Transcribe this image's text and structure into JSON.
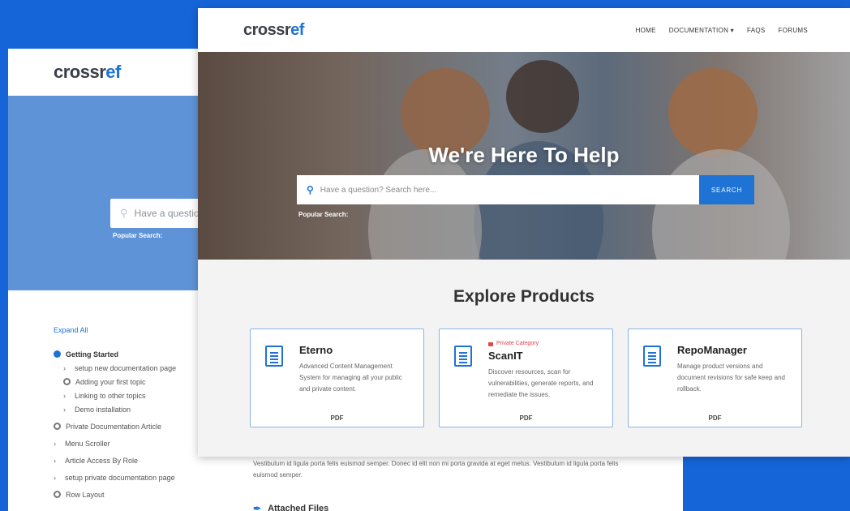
{
  "back": {
    "logo": {
      "part1": "crossr",
      "part2": "ef"
    },
    "search": {
      "placeholder": "Have a questio"
    },
    "popular_label": "Popular Search:",
    "sidebar": {
      "expand_all": "Expand All",
      "items": [
        {
          "label": "Getting Started",
          "type": "group-open"
        },
        {
          "label": "setup new documentation page",
          "type": "sub"
        },
        {
          "label": "Adding your first topic",
          "type": "sub-circle"
        },
        {
          "label": "Linking to other topics",
          "type": "sub"
        },
        {
          "label": "Demo installation",
          "type": "sub"
        },
        {
          "label": "Private Documentation Article",
          "type": "circle"
        },
        {
          "label": "Menu Scroller",
          "type": "arrow"
        },
        {
          "label": "Article Access By Role",
          "type": "arrow"
        },
        {
          "label": "setup private documentation page",
          "type": "arrow"
        },
        {
          "label": "Row Layout",
          "type": "circle"
        }
      ]
    },
    "article_text": "Vestibulum id ligula porta felis euismod semper. Donec id elit non mi porta gravida at eget metus. Vestibulum id ligula porta felis euismod semper.",
    "attached_label": "Attached Files"
  },
  "front": {
    "logo": {
      "part1": "crossr",
      "part2": "ef"
    },
    "nav": {
      "home": "HOME",
      "documentation": "DOCUMENTATION ▾",
      "faqs": "FAQS",
      "forums": "FORUMS"
    },
    "hero_title": "We're Here To Help",
    "search": {
      "placeholder": "Have a question? Search here...",
      "button": "SEARCH"
    },
    "popular_label": "Popular Search:",
    "explore_title": "Explore Products",
    "cards": [
      {
        "name": "Eterno",
        "badge": "",
        "desc": "Advanced Content Management System for managing all your public and private content.",
        "link": "PDF"
      },
      {
        "name": "ScanIT",
        "badge": "Private Category",
        "desc": "Discover resources, scan for vulnerabilities, generate reports, and remediate the issues.",
        "link": "PDF"
      },
      {
        "name": "RepoManager",
        "badge": "",
        "desc": "Manage product versions and document revisions for safe keep and rollback.",
        "link": "PDF"
      }
    ]
  },
  "colors": {
    "accent": "#1e73d4",
    "background": "#1565d8",
    "private": "#e2454d"
  }
}
